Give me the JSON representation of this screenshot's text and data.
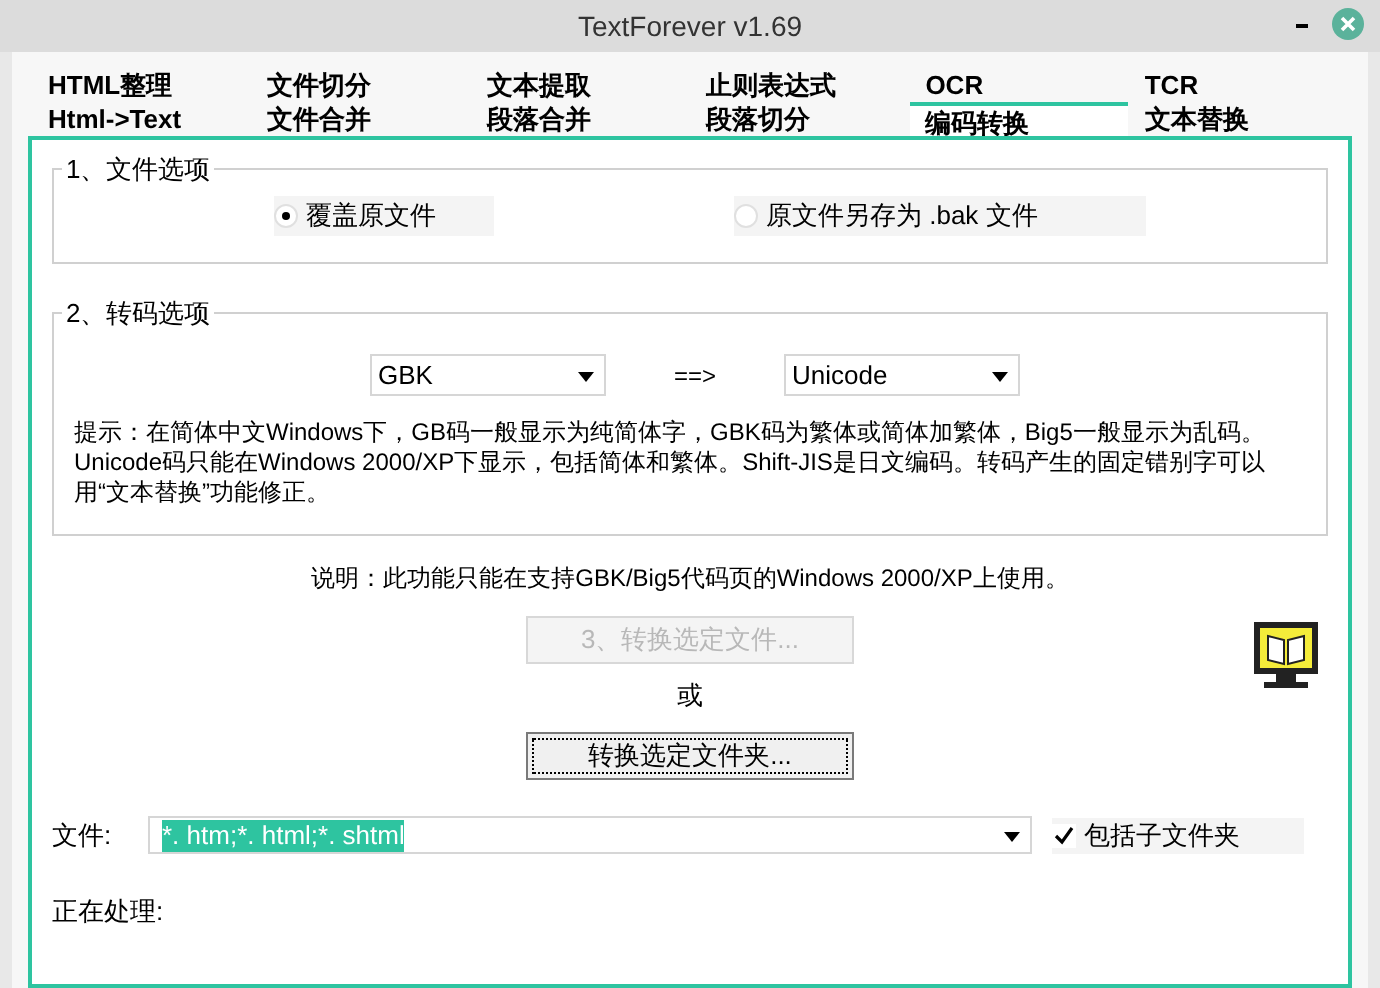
{
  "window": {
    "title": "TextForever v1.69"
  },
  "tab_rows": [
    [
      {
        "label": "HTML整理",
        "selected": false
      },
      {
        "label": "文件切分",
        "selected": false
      },
      {
        "label": "文本提取",
        "selected": false
      },
      {
        "label": "止则表达式",
        "selected": false
      },
      {
        "label": "OCR",
        "selected": false
      },
      {
        "label": "TCR",
        "selected": false
      }
    ],
    [
      {
        "label": "Html->Text",
        "selected": false
      },
      {
        "label": "文件合并",
        "selected": false
      },
      {
        "label": "段落合并",
        "selected": false
      },
      {
        "label": "段落切分",
        "selected": false
      },
      {
        "label": "编码转换",
        "selected": true
      },
      {
        "label": "文本替换",
        "selected": false
      }
    ]
  ],
  "file_options": {
    "title": "1、文件选项",
    "options": [
      {
        "label": "覆盖原文件",
        "selected": true
      },
      {
        "label": "原文件另存为 .bak 文件",
        "selected": false
      }
    ]
  },
  "convert_options": {
    "title": "2、转码选项",
    "from": "GBK",
    "arrow": "==>",
    "to": "Unicode",
    "hint": "提示：在简体中文Windows下，GB码一般显示为纯简体字，GBK码为繁体或简体加繁体，Big5一般显示为乱码。Unicode码只能在Windows 2000/XP下显示，包括简体和繁体。Shift-JIS是日文编码。转码产生的固定错别字可以用“文本替换”功能修正。"
  },
  "note": "说明：此功能只能在支持GBK/Big5代码页的Windows 2000/XP上使用。",
  "convert_files_button": {
    "label": "3、转换选定文件...",
    "disabled": true
  },
  "or": "或",
  "convert_folder_button": {
    "label": "转换选定文件夹...",
    "disabled": false
  },
  "file_label": "文件:",
  "file_value": "*. htm;*. html;*. shtml",
  "include_subfolders": {
    "label": "包括子文件夹",
    "checked": true
  },
  "processing_label": "正在处理:"
}
